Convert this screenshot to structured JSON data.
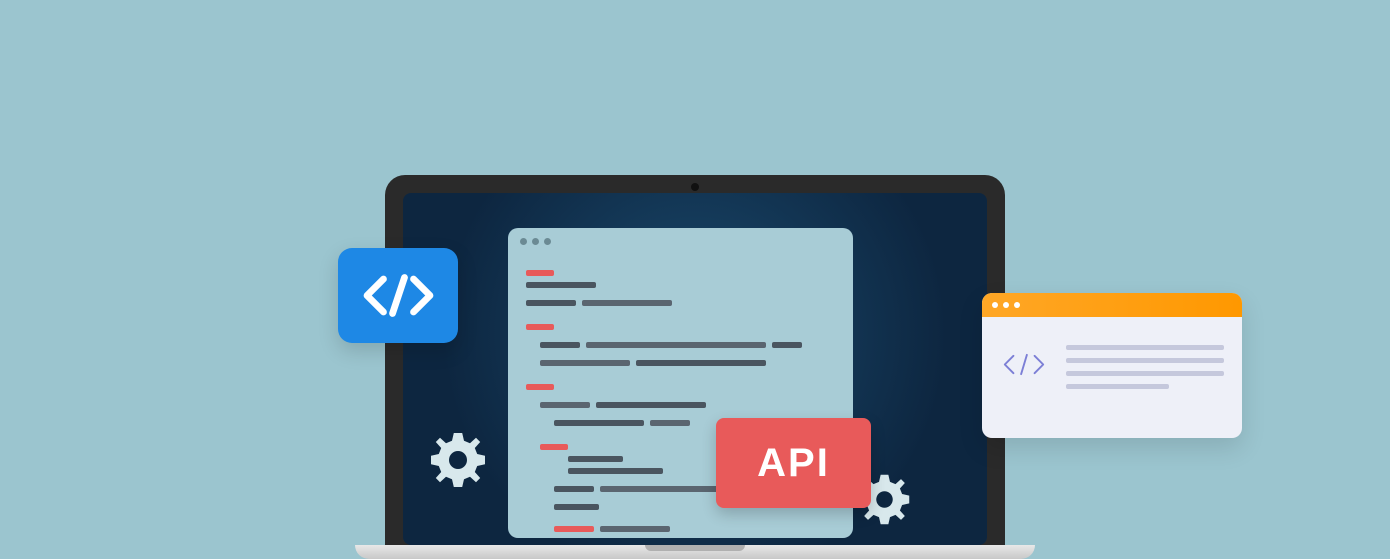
{
  "api_label": "API"
}
